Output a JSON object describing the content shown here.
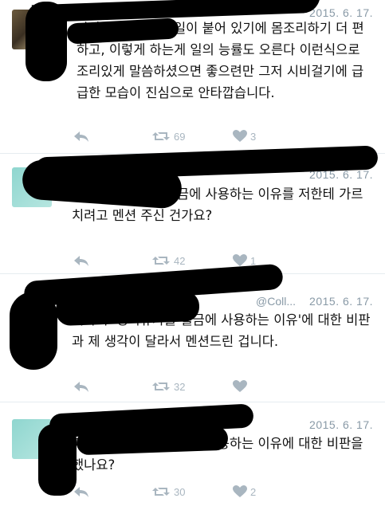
{
  "tweets": [
    {
      "date": "2015. 6. 17.",
      "text": "자라리 월,금은 휴일이 붙어 있기에 몸조리하기 더 편하고, 이렇게 하는게 일의 능률도 오른다 이런식으로 조리있게 말씀하셨으면 좋으련만 그저 시비걸기에 급급한 모습이 진심으로 안타깝습니다.",
      "retweets": "69",
      "likes": "3"
    },
    {
      "date": "2015. 6. 17.",
      "text": "지금 생리휴가를 월금에 사용하는 이유를 저한테 가르치려고 멘션 주신 건가요?",
      "retweets": "42",
      "likes": "1"
    },
    {
      "date": "2015. 6. 17.",
      "header_fragment": "@Coll...",
      "text": "귀하의 '생리휴가를 월금에 사용하는 이유'에 대한 비판과 제 생각이 달라서 멘션드린 겁니다.",
      "retweets": "32",
      "likes": ""
    },
    {
      "date": "2015. 6. 17.",
      "text": "제가 생리휴가를 월금에 사용하는 이유에 대한 비판을 했나요?",
      "retweets": "30",
      "likes": "2"
    }
  ],
  "icons": {
    "reply": "reply-icon",
    "retweet": "retweet-icon",
    "like": "heart-icon"
  },
  "colors": {
    "meta": "#8899a6",
    "action": "#a9b6c0",
    "separator": "#e6ecf0"
  }
}
